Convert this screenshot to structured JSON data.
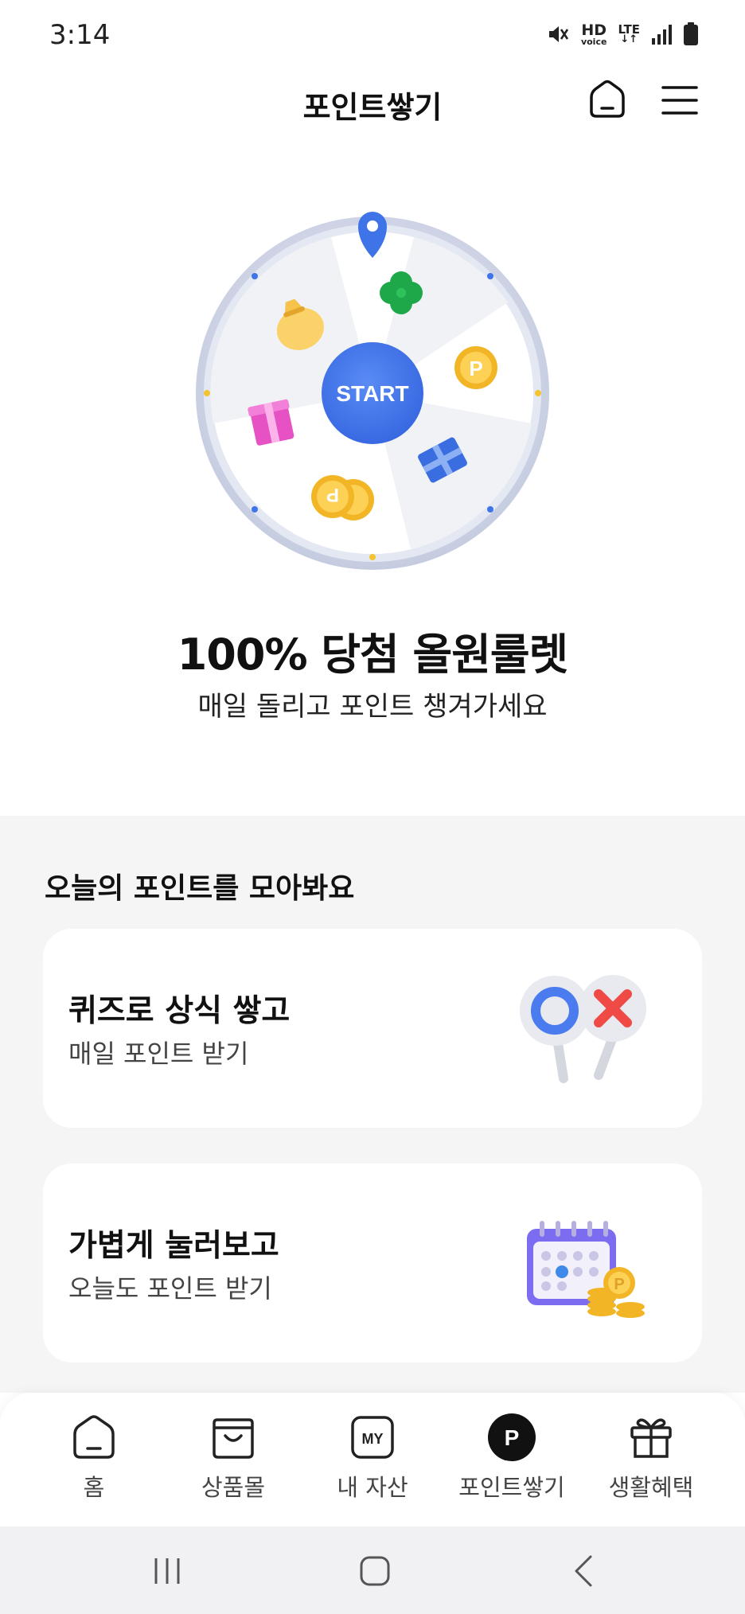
{
  "status_bar": {
    "time": "3:14",
    "icons": [
      "mute-icon",
      "hd-voice-icon",
      "lte-icon",
      "signal-icon",
      "battery-icon"
    ],
    "hd_label": "HD",
    "voice_label": "voice",
    "lte_label": "LTE"
  },
  "header": {
    "title": "포인트쌓기",
    "icons": [
      "home-icon",
      "menu-icon"
    ]
  },
  "roulette": {
    "start_label": "START",
    "prizes": [
      "clover",
      "point-coin",
      "gift-box-blue",
      "coins",
      "gift-box-pink",
      "money-bag"
    ],
    "coin_letter": "P"
  },
  "promo": {
    "title": "100% 당첨 올원룰렛",
    "subtitle": "매일 돌리고 포인트 챙겨가세요"
  },
  "section": {
    "title": "오늘의 포인트를 모아봐요",
    "cards": [
      {
        "title": "퀴즈로 상식 쌓고",
        "subtitle": "매일 포인트 받기",
        "icon": "ox-quiz-icon"
      },
      {
        "title": "가볍게 눌러보고",
        "subtitle": "오늘도 포인트 받기",
        "icon": "calendar-coins-icon"
      }
    ]
  },
  "bottom_nav": {
    "items": [
      {
        "label": "홈",
        "icon": "home-icon"
      },
      {
        "label": "상품몰",
        "icon": "shopping-bag-icon"
      },
      {
        "label": "내 자산",
        "icon": "my-assets-icon",
        "badge": "MY"
      },
      {
        "label": "포인트쌓기",
        "icon": "point-icon",
        "badge": "P",
        "active": true
      },
      {
        "label": "생활혜택",
        "icon": "gift-icon"
      }
    ]
  },
  "system_nav": {
    "buttons": [
      "recent-apps-icon",
      "home-button-icon",
      "back-icon"
    ]
  },
  "colors": {
    "accent_blue": "#3f73e8",
    "section_bg": "#f5f5f6",
    "text_primary": "#111111",
    "text_secondary": "#444444"
  }
}
